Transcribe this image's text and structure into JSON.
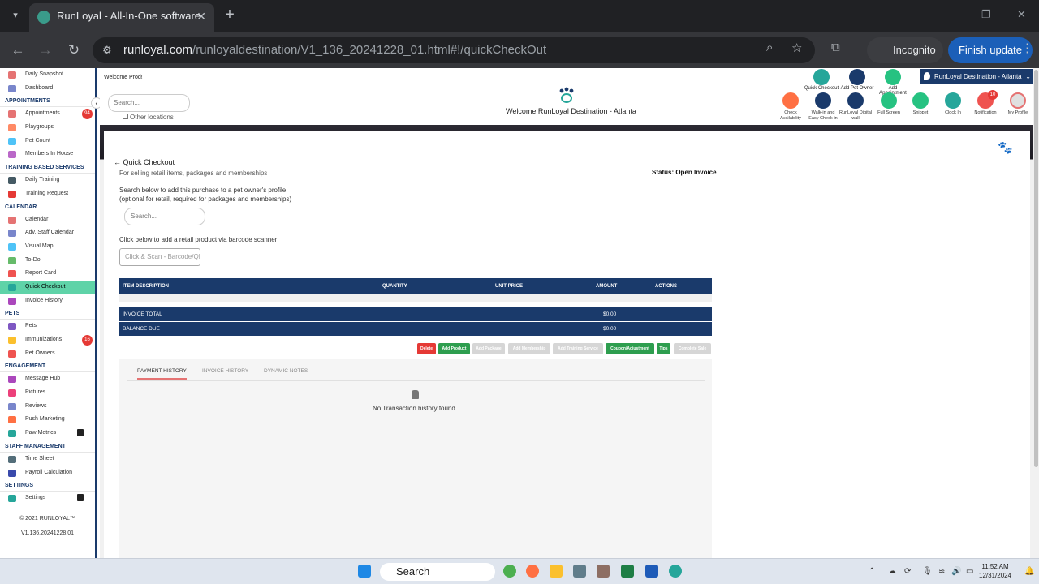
{
  "browser": {
    "tab_title": "RunLoyal - All-In-One software",
    "url_host": "runloyal.com",
    "url_path": "/runloyaldestination/V1_136_20241228_01.html#!/quickCheckOut",
    "incognito_label": "Incognito",
    "update_label": "Finish update"
  },
  "sidebar": {
    "items_top": [
      {
        "label": "Daily Snapshot",
        "color": "#e57373"
      },
      {
        "label": "Dashboard",
        "color": "#7986cb"
      }
    ],
    "appointments_header": "APPOINTMENTS",
    "appointments": [
      {
        "label": "Appointments",
        "color": "#e57373",
        "badge": "94"
      },
      {
        "label": "Playgroups",
        "color": "#ff8a65"
      },
      {
        "label": "Pet Count",
        "color": "#4fc3f7"
      },
      {
        "label": "Members In House",
        "color": "#ba68c8"
      }
    ],
    "training_header": "TRAINING BASED SERVICES",
    "training": [
      {
        "label": "Daily Training",
        "color": "#455a64"
      },
      {
        "label": "Training Request",
        "color": "#e53935"
      }
    ],
    "calendar_header": "CALENDAR",
    "calendar": [
      {
        "label": "Calendar",
        "color": "#e57373"
      },
      {
        "label": "Adv. Staff Calendar",
        "color": "#7986cb"
      },
      {
        "label": "Visual Map",
        "color": "#4fc3f7"
      },
      {
        "label": "To-Do",
        "color": "#66bb6a"
      },
      {
        "label": "Report Card",
        "color": "#ef5350"
      },
      {
        "label": "Quick Checkout",
        "color": "#26a69a",
        "active": true
      },
      {
        "label": "Invoice History",
        "color": "#ab47bc"
      }
    ],
    "pets_header": "PETS",
    "pets": [
      {
        "label": "Pets",
        "color": "#7e57c2"
      },
      {
        "label": "Immunizations",
        "color": "#fbc02d",
        "badge": "16"
      },
      {
        "label": "Pet Owners",
        "color": "#ef5350"
      }
    ],
    "engagement_header": "ENGAGEMENT",
    "engagement": [
      {
        "label": "Message Hub",
        "color": "#ab47bc"
      },
      {
        "label": "Pictures",
        "color": "#ec407a"
      },
      {
        "label": "Reviews",
        "color": "#7986cb"
      },
      {
        "label": "Push Marketing",
        "color": "#ff7043"
      },
      {
        "label": "Paw Metrics",
        "color": "#26a69a",
        "locked": true
      }
    ],
    "staff_header": "STAFF MANAGEMENT",
    "staff": [
      {
        "label": "Time Sheet",
        "color": "#546e7a"
      },
      {
        "label": "Payroll Calculation",
        "color": "#3949ab"
      }
    ],
    "settings_header": "SETTINGS",
    "settings": [
      {
        "label": "Settings",
        "color": "#26a69a",
        "locked": true
      }
    ],
    "copyright": "© 2021  RUNLOYAL™",
    "version": "V1.136.20241228.01"
  },
  "topbar": {
    "welcome_user": "Welcome Prod!",
    "search_placeholder": "Search...",
    "other_locations": "Other locations",
    "center_title": "Welcome RunLoyal Destination - Atlanta",
    "location": "RunLoyal Destination - Atlanta",
    "quick_actions": [
      {
        "label": "Quick Checkout",
        "color": "#26a69a"
      },
      {
        "label": "Add Pet Owner",
        "color": "#1a3a6b"
      },
      {
        "label": "Add Appointment",
        "color": "#26c281"
      }
    ],
    "tools": [
      {
        "label": "Check Availability",
        "color": "#ff7043"
      },
      {
        "label": "Walk-in and Easy Check-in",
        "color": "#1a3a6b"
      },
      {
        "label": "RunLoyal Digital wall",
        "color": "#1a3a6b"
      },
      {
        "label": "Full Screen",
        "color": "#26c281"
      },
      {
        "label": "Snippet",
        "color": "#26c281"
      },
      {
        "label": "Clock In",
        "color": "#26a69a"
      },
      {
        "label": "Notification",
        "color": "#ef5350",
        "badge": "10"
      },
      {
        "label": "My Profile",
        "color": "#e0e0e0"
      }
    ]
  },
  "checkout": {
    "title": "Quick Checkout",
    "subtitle": "For selling retail items, packages and memberships",
    "status": "Status: Open Invoice",
    "search_desc_1": "Search below to add this purchase to a pet owner's profile",
    "search_desc_2": "(optional for retail, required for packages and memberships)",
    "search_placeholder": "Search...",
    "barcode_label": "Click below to add a retail product via barcode scanner",
    "barcode_placeholder": "Click & Scan - Barcode/QR",
    "columns": {
      "item": "ITEM DESCRIPTION",
      "qty": "QUANTITY",
      "price": "UNIT PRICE",
      "amount": "AMOUNT",
      "actions": "ACTIONS"
    },
    "invoice_total_label": "INVOICE TOTAL",
    "invoice_total": "$0.00",
    "balance_due_label": "BALANCE DUE",
    "balance_due": "$0.00",
    "buttons": {
      "delete": "Delete",
      "add_product": "Add Product",
      "add_package": "Add Package",
      "add_membership": "Add Membership",
      "add_training": "Add Training Service",
      "coupon": "Coupon/Adjustment",
      "tips": "Tips",
      "complete": "Complete Sale"
    },
    "history_tabs": [
      "PAYMENT HISTORY",
      "INVOICE HISTORY",
      "DYNAMIC NOTES"
    ],
    "no_history": "No Transaction history found"
  },
  "taskbar": {
    "search": "Search",
    "time": "11:52 AM",
    "date": "12/31/2024"
  }
}
